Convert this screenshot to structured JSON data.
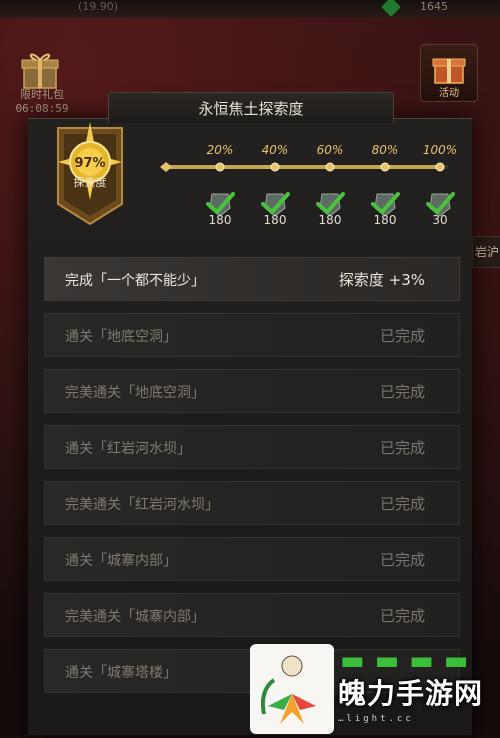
{
  "hud": {
    "top_value_left": "(19.90)",
    "top_value_right": "1645",
    "gift_label": "限时礼包",
    "timer": "06:08:59",
    "activity_label": "活动",
    "side_tab": "岩",
    "side_tab_right": "沪"
  },
  "panel": {
    "title": "永恒焦土探索度",
    "emblem": {
      "percent": "97%",
      "label": "探索度"
    },
    "progress": {
      "value": 0.97,
      "milestones": [
        {
          "label": "20%",
          "reward": "180"
        },
        {
          "label": "40%",
          "reward": "180"
        },
        {
          "label": "60%",
          "reward": "180"
        },
        {
          "label": "80%",
          "reward": "180"
        },
        {
          "label": "100%",
          "reward": "30"
        }
      ]
    },
    "tasks": [
      {
        "name": "完成「一个都不能少」",
        "status": "探索度 +3%",
        "done": false
      },
      {
        "name": "通关「地底空洞」",
        "status": "已完成",
        "done": true
      },
      {
        "name": "完美通关「地底空洞」",
        "status": "已完成",
        "done": true
      },
      {
        "name": "通关「红岩河水坝」",
        "status": "已完成",
        "done": true
      },
      {
        "name": "完美通关「红岩河水坝」",
        "status": "已完成",
        "done": true
      },
      {
        "name": "通关「城寨内部」",
        "status": "已完成",
        "done": true
      },
      {
        "name": "完美通关「城寨内部」",
        "status": "已完成",
        "done": true
      },
      {
        "name": "通关「城寨塔楼」",
        "status": "",
        "done": true
      }
    ]
  },
  "watermark": {
    "text": "魄力手游网",
    "url": "…light.cc"
  },
  "colors": {
    "accent_gold": "#e6c36b",
    "check_green": "#49c23d",
    "done_text": "#7c756d"
  }
}
